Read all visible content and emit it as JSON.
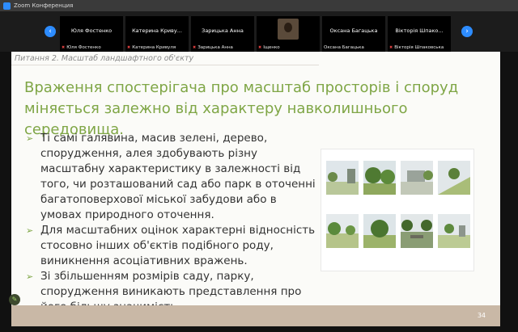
{
  "window": {
    "title": "Zoom Конференция"
  },
  "strip": {
    "participants": [
      {
        "name": "Юля Фостенко",
        "label": "Юля Фостенко"
      },
      {
        "name": "Катерина Криву...",
        "label": "Катерина Кривуля"
      },
      {
        "name": "Зарицька Анна",
        "label": "Зарицька Анна"
      },
      {
        "name": "",
        "label": "Іщенко"
      },
      {
        "name": "Оксана Багацька",
        "label": "Оксана Багацька"
      },
      {
        "name": "Вікторія Шпако...",
        "label": "Вікторія Шпаковська"
      }
    ]
  },
  "slide": {
    "topic": "Питання 2. Масштаб ландшафтного об'єкту",
    "heading": "Враження спостерігача про масштаб просторів і споруд міняється залежно від характеру навколишнього середовища.",
    "bullets": [
      "Ті самі галявина, масив зелені, дерево, спорудження, алея здобувають різну масштабну характеристику в залежності від того, чи розташований сад або парк в оточенні багатоповерхової міської забудови або в умовах природного оточення.",
      "Для масштабних оцінок характерні відносність стосовно інших об'єктів подібного роду, виникнення асоціативних вражень.",
      "Зі збільшенням розмірів саду, парку, спорудження виникають представлення про його більшу значимість."
    ],
    "page_number": "34"
  },
  "colors": {
    "accent": "#7fa646",
    "footer": "#c9b8a6",
    "zoom_blue": "#2d8cff"
  },
  "icons": {
    "prev": "chevron-left-icon",
    "next": "chevron-right-icon",
    "pen": "pen-icon"
  }
}
